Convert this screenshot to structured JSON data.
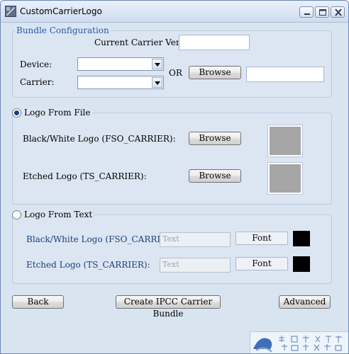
{
  "window": {
    "title": "CustomCarrierLogo"
  },
  "bundle": {
    "title": "Bundle Configuration",
    "version_label": "Current Carrier Version:",
    "version_value": "",
    "device_label": "Device:",
    "device_value": "",
    "carrier_label": "Carrier:",
    "carrier_value": "",
    "or_label": "OR",
    "browse_label": "Browse",
    "path_value": ""
  },
  "logo_file": {
    "radio_label": "Logo From File",
    "selected": true,
    "bw_label": "Black/White Logo  (FSO_CARRIER):",
    "bw_browse": "Browse",
    "etched_label": "Etched Logo (TS_CARRIER):",
    "etched_browse": "Browse"
  },
  "logo_text": {
    "radio_label": "Logo From Text",
    "selected": false,
    "bw_label": "Black/White Logo  (FSO_CARRIER):",
    "bw_placeholder": "Text",
    "bw_font": "Font",
    "etched_label": "Etched Logo (TS_CARRIER):",
    "etched_placeholder": "Text",
    "etched_font": "Font",
    "swatch_color": "#000000"
  },
  "footer": {
    "back": "Back",
    "create": "Create IPCC Carrier Bundle",
    "advanced": "Advanced"
  },
  "icons": {
    "app": "app-icon",
    "minimize": "minimize-icon",
    "maximize": "maximize-icon",
    "close": "close-icon",
    "dropdown": "chevron-down-icon"
  },
  "colors": {
    "group_title": "#1f5aa8",
    "window_bg": "#d9e4f1",
    "preview_gray": "#a6a6a6"
  }
}
